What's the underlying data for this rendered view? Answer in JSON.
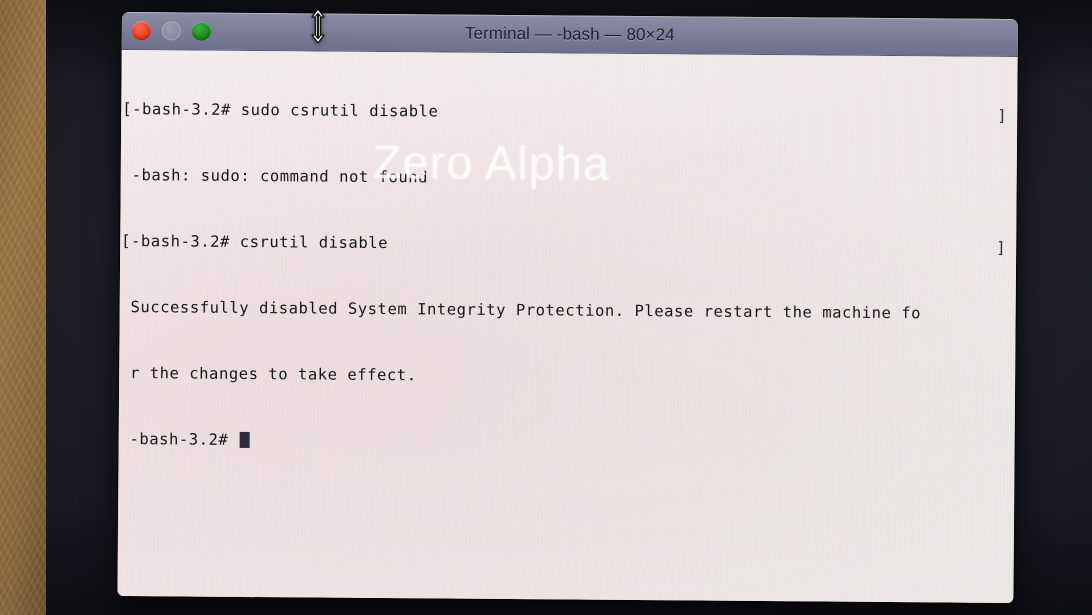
{
  "window": {
    "title": "Terminal — -bash — 80×24",
    "app_name": "Terminal",
    "shell": "-bash",
    "geometry": "80×24",
    "controls": {
      "close_label": "Close",
      "minimize_label": "Minimize",
      "zoom_label": "Zoom"
    }
  },
  "colors": {
    "titlebar": "#7d7f99",
    "terminal_background": "#efeae9",
    "terminal_text": "#15151b",
    "close_button": "#ee3b20",
    "minimize_button": "#8a8ca2",
    "zoom_button": "#1f8c20",
    "desktop": "#1b1c26",
    "wood_panel": "#8d6c3e",
    "cursor_block": "#2b2c3c"
  },
  "terminal": {
    "prompt": "-bash-3.2#",
    "lines": [
      {
        "text": "[-bash-3.2# sudo csrutil disable",
        "edge": "]"
      },
      {
        "text": " -bash: sudo: command not found",
        "edge": ""
      },
      {
        "text": "[-bash-3.2# csrutil disable",
        "edge": "]"
      },
      {
        "text": " Successfully disabled System Integrity Protection. Please restart the machine fo",
        "edge": ""
      },
      {
        "text": " r the changes to take effect.",
        "edge": ""
      },
      {
        "text": " -bash-3.2# ",
        "edge": "",
        "cursor": true
      }
    ]
  },
  "overlay": {
    "watermark": "Zero Alpha",
    "cursor_name": "vertical-resize-cursor"
  }
}
